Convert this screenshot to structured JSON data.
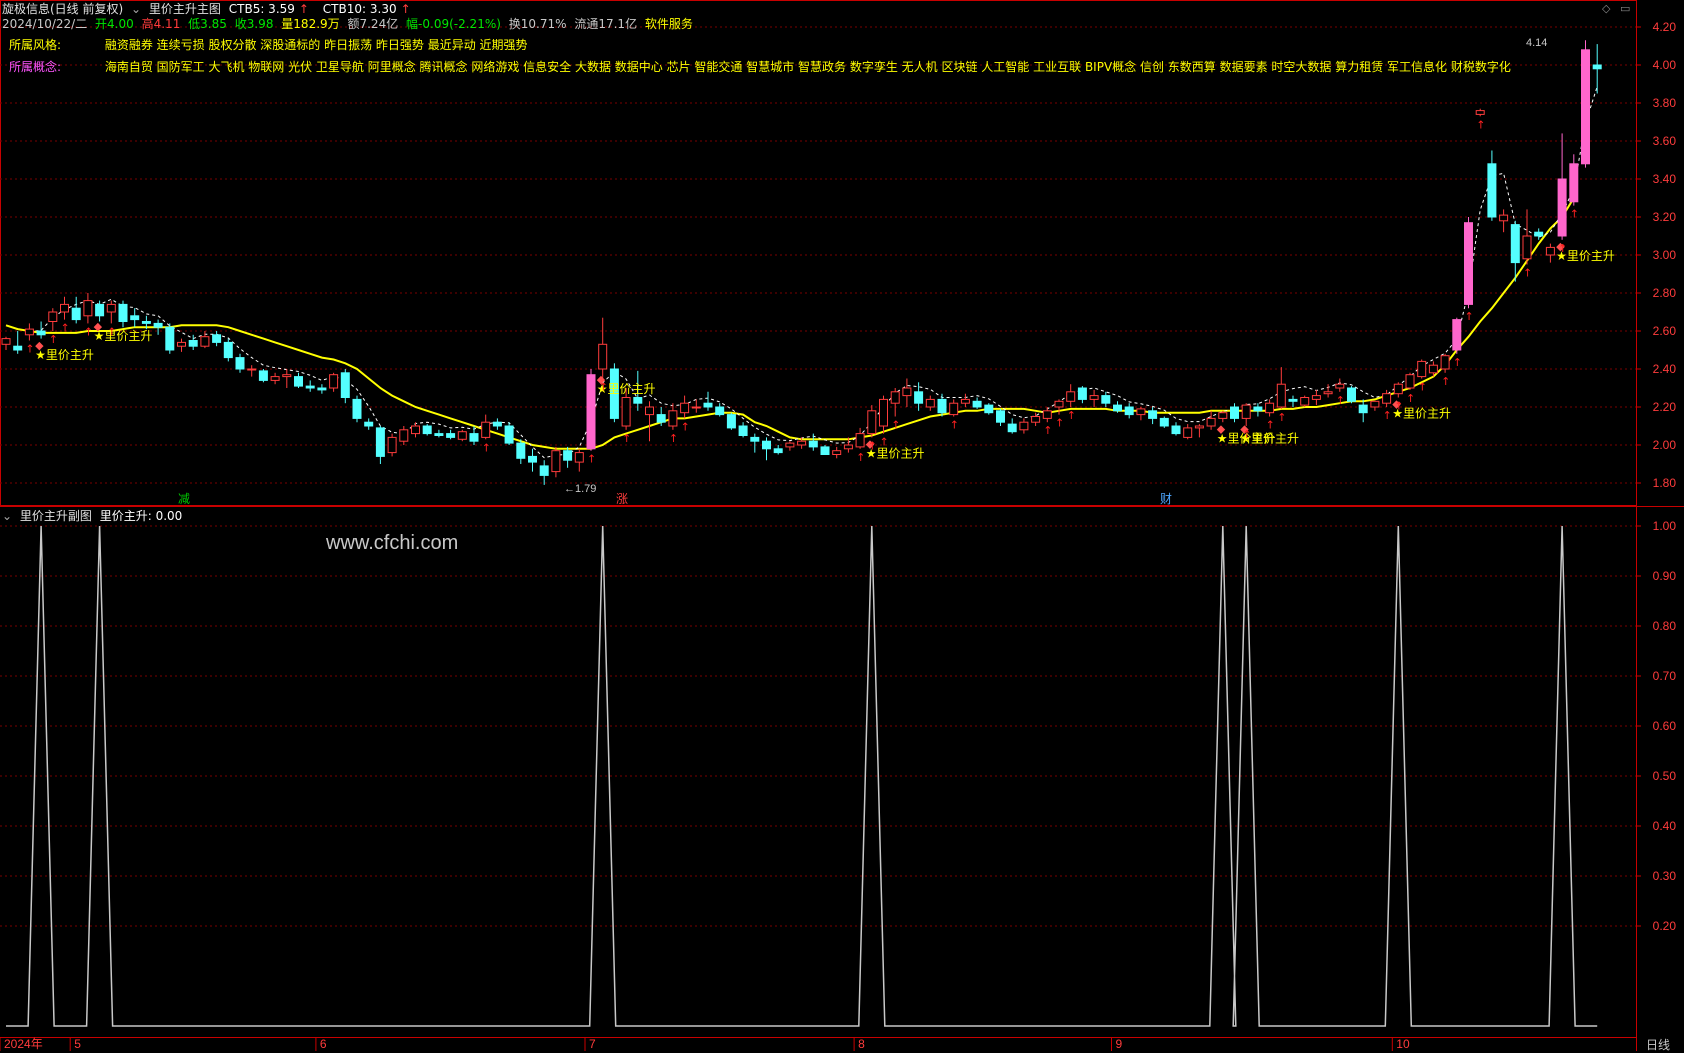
{
  "header": {
    "title": "旋极信息(日线 前复权)",
    "indicator_name": "里价主升主图",
    "ctb5_label": "CTB5: 3.59",
    "ctb10_label": "CTB10: 3.30",
    "arrow": "↑",
    "date": "2024/10/22/二",
    "open": "开4.00",
    "high": "高4.11",
    "low": "低3.85",
    "close": "收3.98",
    "volume": "量182.9万",
    "amount": "额7.24亿",
    "change": "幅-0.09(-2.21%)",
    "turnover": "换10.71%",
    "float_cap": "流通17.1亿",
    "service": "软件服务"
  },
  "style_row": {
    "label": "所属风格:",
    "text": "融资融券 连续亏损 股权分散 深股通标的 昨日振荡 昨日强势 最近异动 近期强势"
  },
  "concept_row": {
    "label": "所属概念:",
    "text": "海南自贸 国防军工 大飞机 物联网 光伏 卫星导航 阿里概念 腾讯概念 网络游戏 信息安全 大数据 数据中心 芯片 智能交通 智慧城市 智慧政务 数字孪生 无人机 区块链 人工智能 工业互联 BIPV概念 信创 东数西算 数据要素 时空大数据 算力租赁 军工信息化 财税数字化"
  },
  "sub_header": {
    "name": "里价主升副图",
    "value_label": "里价主升: 0.00"
  },
  "watermark": "www.cfchi.com",
  "period_label": "日线",
  "markers": {
    "jian": "减",
    "zhang": "涨",
    "cai": "财"
  },
  "signal_text": "★里价主升",
  "hi_label": "4.14",
  "lo_label": "1.79",
  "colors": {
    "up": "#ff3c3c",
    "down": "#54ffff",
    "ma": "#ffff00",
    "grid": "#7a0000",
    "axis": "#c80000",
    "signal": "#ff66cc"
  },
  "chart_data": [
    {
      "type": "candlestick",
      "title": "里价主升主图",
      "ylim": [
        1.72,
        4.24
      ],
      "yticks": [
        "4.20",
        "4.00",
        "3.80",
        "3.60",
        "3.40",
        "3.20",
        "3.00",
        "2.80",
        "2.60",
        "2.40",
        "2.20",
        "2.00",
        "1.80"
      ],
      "xticks": [
        "2024年",
        "5",
        "6",
        "7",
        "8",
        "9",
        "10"
      ],
      "ohlc": [
        [
          2.53,
          2.57,
          2.5,
          2.56
        ],
        [
          2.52,
          2.6,
          2.48,
          2.5
        ],
        [
          2.58,
          2.64,
          2.55,
          2.61
        ],
        [
          2.6,
          2.65,
          2.56,
          2.58
        ],
        [
          2.65,
          2.72,
          2.6,
          2.7
        ],
        [
          2.7,
          2.78,
          2.66,
          2.74
        ],
        [
          2.72,
          2.78,
          2.64,
          2.66
        ],
        [
          2.68,
          2.8,
          2.64,
          2.76
        ],
        [
          2.74,
          2.76,
          2.65,
          2.68
        ],
        [
          2.7,
          2.76,
          2.64,
          2.74
        ],
        [
          2.74,
          2.76,
          2.62,
          2.65
        ],
        [
          2.68,
          2.72,
          2.62,
          2.66
        ],
        [
          2.65,
          2.68,
          2.61,
          2.64
        ],
        [
          2.64,
          2.66,
          2.58,
          2.62
        ],
        [
          2.62,
          2.64,
          2.48,
          2.5
        ],
        [
          2.52,
          2.56,
          2.49,
          2.54
        ],
        [
          2.55,
          2.58,
          2.5,
          2.52
        ],
        [
          2.52,
          2.6,
          2.51,
          2.57
        ],
        [
          2.58,
          2.6,
          2.52,
          2.54
        ],
        [
          2.54,
          2.56,
          2.44,
          2.46
        ],
        [
          2.46,
          2.48,
          2.38,
          2.4
        ],
        [
          2.4,
          2.42,
          2.36,
          2.4
        ],
        [
          2.39,
          2.4,
          2.33,
          2.34
        ],
        [
          2.34,
          2.38,
          2.32,
          2.36
        ],
        [
          2.36,
          2.4,
          2.3,
          2.37
        ],
        [
          2.36,
          2.38,
          2.3,
          2.31
        ],
        [
          2.31,
          2.34,
          2.28,
          2.3
        ],
        [
          2.3,
          2.32,
          2.27,
          2.29
        ],
        [
          2.3,
          2.38,
          2.28,
          2.37
        ],
        [
          2.38,
          2.4,
          2.22,
          2.25
        ],
        [
          2.24,
          2.26,
          2.12,
          2.14
        ],
        [
          2.12,
          2.14,
          2.08,
          2.1
        ],
        [
          2.09,
          2.1,
          1.9,
          1.94
        ],
        [
          1.96,
          2.06,
          1.94,
          2.04
        ],
        [
          2.02,
          2.1,
          2.0,
          2.08
        ],
        [
          2.06,
          2.12,
          2.04,
          2.1
        ],
        [
          2.1,
          2.11,
          2.05,
          2.06
        ],
        [
          2.06,
          2.08,
          2.04,
          2.05
        ],
        [
          2.06,
          2.08,
          2.03,
          2.04
        ],
        [
          2.03,
          2.08,
          2.02,
          2.07
        ],
        [
          2.06,
          2.1,
          2.0,
          2.02
        ],
        [
          2.04,
          2.16,
          2.03,
          2.12
        ],
        [
          2.12,
          2.14,
          2.08,
          2.1
        ],
        [
          2.1,
          2.12,
          2.0,
          2.01
        ],
        [
          2.01,
          2.03,
          1.9,
          1.93
        ],
        [
          1.94,
          1.98,
          1.86,
          1.91
        ],
        [
          1.89,
          1.92,
          1.79,
          1.84
        ],
        [
          1.86,
          1.99,
          1.83,
          1.97
        ],
        [
          1.97,
          1.99,
          1.88,
          1.92
        ],
        [
          1.91,
          1.98,
          1.86,
          1.96
        ],
        [
          1.98,
          2.4,
          1.97,
          2.37
        ],
        [
          2.4,
          2.67,
          2.35,
          2.53
        ],
        [
          2.4,
          2.43,
          2.12,
          2.14
        ],
        [
          2.1,
          2.3,
          2.08,
          2.25
        ],
        [
          2.25,
          2.39,
          2.18,
          2.22
        ],
        [
          2.16,
          2.23,
          2.02,
          2.2
        ],
        [
          2.16,
          2.2,
          2.1,
          2.12
        ],
        [
          2.1,
          2.22,
          2.08,
          2.18
        ],
        [
          2.17,
          2.26,
          2.14,
          2.22
        ],
        [
          2.2,
          2.24,
          2.17,
          2.2
        ],
        [
          2.22,
          2.28,
          2.18,
          2.2
        ],
        [
          2.2,
          2.22,
          2.15,
          2.16
        ],
        [
          2.16,
          2.17,
          2.08,
          2.09
        ],
        [
          2.1,
          2.12,
          2.04,
          2.05
        ],
        [
          2.04,
          2.06,
          1.96,
          2.02
        ],
        [
          2.02,
          2.04,
          1.92,
          1.98
        ],
        [
          1.98,
          2.0,
          1.95,
          1.96
        ],
        [
          1.99,
          2.02,
          1.97,
          2.01
        ],
        [
          2.0,
          2.04,
          1.98,
          2.02
        ],
        [
          2.02,
          2.06,
          1.97,
          1.99
        ],
        [
          1.99,
          2.0,
          1.95,
          1.95
        ],
        [
          1.95,
          1.99,
          1.93,
          1.97
        ],
        [
          1.98,
          2.04,
          1.96,
          2.0
        ],
        [
          1.99,
          2.09,
          1.98,
          2.06
        ],
        [
          2.06,
          2.21,
          2.04,
          2.18
        ],
        [
          2.1,
          2.26,
          2.06,
          2.24
        ],
        [
          2.22,
          2.3,
          2.15,
          2.28
        ],
        [
          2.26,
          2.35,
          2.2,
          2.3
        ],
        [
          2.28,
          2.33,
          2.18,
          2.22
        ],
        [
          2.2,
          2.26,
          2.18,
          2.24
        ],
        [
          2.24,
          2.27,
          2.15,
          2.17
        ],
        [
          2.16,
          2.24,
          2.15,
          2.22
        ],
        [
          2.22,
          2.27,
          2.2,
          2.24
        ],
        [
          2.23,
          2.25,
          2.19,
          2.2
        ],
        [
          2.21,
          2.22,
          2.16,
          2.17
        ],
        [
          2.18,
          2.19,
          2.1,
          2.12
        ],
        [
          2.11,
          2.14,
          2.06,
          2.07
        ],
        [
          2.08,
          2.14,
          2.06,
          2.12
        ],
        [
          2.12,
          2.17,
          2.1,
          2.15
        ],
        [
          2.14,
          2.2,
          2.12,
          2.18
        ],
        [
          2.2,
          2.24,
          2.16,
          2.23
        ],
        [
          2.23,
          2.32,
          2.2,
          2.28
        ],
        [
          2.3,
          2.31,
          2.22,
          2.24
        ],
        [
          2.24,
          2.29,
          2.2,
          2.26
        ],
        [
          2.26,
          2.28,
          2.2,
          2.22
        ],
        [
          2.21,
          2.23,
          2.17,
          2.18
        ],
        [
          2.2,
          2.22,
          2.14,
          2.16
        ],
        [
          2.16,
          2.2,
          2.13,
          2.19
        ],
        [
          2.18,
          2.2,
          2.11,
          2.14
        ],
        [
          2.14,
          2.15,
          2.09,
          2.1
        ],
        [
          2.1,
          2.12,
          2.05,
          2.06
        ],
        [
          2.04,
          2.11,
          2.03,
          2.09
        ],
        [
          2.09,
          2.11,
          2.04,
          2.1
        ],
        [
          2.1,
          2.18,
          2.08,
          2.14
        ],
        [
          2.14,
          2.18,
          2.12,
          2.17
        ],
        [
          2.2,
          2.22,
          2.12,
          2.14
        ],
        [
          2.14,
          2.22,
          2.1,
          2.21
        ],
        [
          2.2,
          2.22,
          2.15,
          2.18
        ],
        [
          2.17,
          2.24,
          2.15,
          2.22
        ],
        [
          2.2,
          2.41,
          2.19,
          2.32
        ],
        [
          2.24,
          2.26,
          2.2,
          2.23
        ],
        [
          2.21,
          2.26,
          2.2,
          2.25
        ],
        [
          2.24,
          2.29,
          2.21,
          2.26
        ],
        [
          2.27,
          2.32,
          2.25,
          2.28
        ],
        [
          2.3,
          2.35,
          2.28,
          2.32
        ],
        [
          2.3,
          2.31,
          2.22,
          2.23
        ],
        [
          2.21,
          2.24,
          2.12,
          2.17
        ],
        [
          2.2,
          2.23,
          2.18,
          2.23
        ],
        [
          2.22,
          2.29,
          2.2,
          2.27
        ],
        [
          2.27,
          2.33,
          2.25,
          2.32
        ],
        [
          2.3,
          2.38,
          2.29,
          2.37
        ],
        [
          2.36,
          2.45,
          2.35,
          2.44
        ],
        [
          2.38,
          2.44,
          2.36,
          2.42
        ],
        [
          2.4,
          2.48,
          2.38,
          2.47
        ],
        [
          2.5,
          2.67,
          2.48,
          2.66
        ],
        [
          2.74,
          3.2,
          2.72,
          3.17
        ],
        [
          3.74,
          3.77,
          3.73,
          3.76
        ],
        [
          3.48,
          3.55,
          3.18,
          3.2
        ],
        [
          3.18,
          3.24,
          3.12,
          3.21
        ],
        [
          3.16,
          3.18,
          2.86,
          2.96
        ],
        [
          2.98,
          3.24,
          2.95,
          3.1
        ],
        [
          3.12,
          3.14,
          3.08,
          3.1
        ],
        [
          3.0,
          3.06,
          2.96,
          3.04
        ],
        [
          3.1,
          3.64,
          3.08,
          3.4
        ],
        [
          3.28,
          3.53,
          3.26,
          3.48
        ],
        [
          3.48,
          4.13,
          3.46,
          4.08
        ],
        [
          4.0,
          4.11,
          3.85,
          3.98
        ]
      ],
      "ma": [
        2.63,
        2.61,
        2.6,
        2.59,
        2.59,
        2.59,
        2.59,
        2.6,
        2.6,
        2.6,
        2.61,
        2.62,
        2.62,
        2.62,
        2.62,
        2.63,
        2.63,
        2.63,
        2.63,
        2.62,
        2.6,
        2.58,
        2.56,
        2.54,
        2.52,
        2.5,
        2.48,
        2.46,
        2.45,
        2.43,
        2.4,
        2.35,
        2.3,
        2.26,
        2.23,
        2.2,
        2.18,
        2.16,
        2.14,
        2.12,
        2.1,
        2.08,
        2.06,
        2.04,
        2.02,
        2.0,
        1.99,
        1.98,
        1.98,
        1.98,
        1.98,
        2.0,
        2.04,
        2.06,
        2.08,
        2.1,
        2.12,
        2.14,
        2.14,
        2.15,
        2.16,
        2.17,
        2.17,
        2.16,
        2.12,
        2.1,
        2.07,
        2.04,
        2.03,
        2.03,
        2.03,
        2.03,
        2.03,
        2.04,
        2.05,
        2.07,
        2.09,
        2.11,
        2.13,
        2.15,
        2.16,
        2.17,
        2.18,
        2.18,
        2.19,
        2.19,
        2.19,
        2.19,
        2.18,
        2.17,
        2.18,
        2.19,
        2.19,
        2.19,
        2.19,
        2.18,
        2.18,
        2.18,
        2.17,
        2.17,
        2.17,
        2.17,
        2.17,
        2.18,
        2.18,
        2.18,
        2.18,
        2.18,
        2.18,
        2.19,
        2.19,
        2.2,
        2.2,
        2.21,
        2.22,
        2.23,
        2.23,
        2.24,
        2.26,
        2.28,
        2.3,
        2.33,
        2.36,
        2.42,
        2.5,
        2.57,
        2.65,
        2.72,
        2.8,
        2.88,
        2.97,
        3.06,
        3.14,
        3.2,
        3.3
      ],
      "signals": [
        3,
        8,
        51,
        74,
        104,
        106,
        119,
        133
      ]
    },
    {
      "type": "line",
      "title": "里价主升副图",
      "ylim": [
        0,
        1.0
      ],
      "yticks": [
        "1.00",
        "0.90",
        "0.80",
        "0.70",
        "0.60",
        "0.50",
        "0.40",
        "0.30",
        "0.20"
      ],
      "signal_indices": [
        3,
        8,
        51,
        74,
        104,
        106,
        119,
        133
      ]
    }
  ]
}
